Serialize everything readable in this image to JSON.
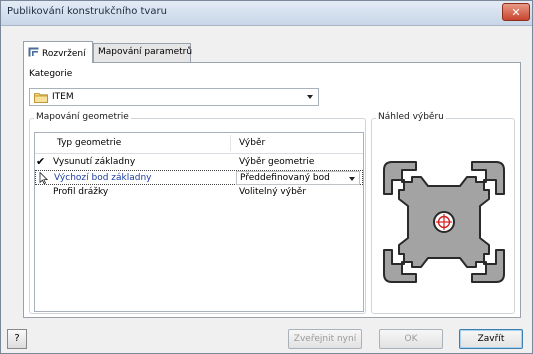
{
  "window": {
    "title": "Publikování konstrukčního tvaru",
    "close_label": "✕"
  },
  "tabs": [
    {
      "label": "Rozvržení",
      "active": true
    },
    {
      "label": "Mapování parametrů",
      "active": false
    }
  ],
  "category": {
    "label": "Kategorie",
    "value": "ITEM",
    "icon": "folder-icon"
  },
  "geometry_mapping": {
    "title": "Mapování geometrie",
    "columns": [
      "Typ geometrie",
      "Výběr"
    ],
    "rows": [
      {
        "type": "Vysunutí základny",
        "selection": "Výběr geometrie",
        "marker": "✔"
      },
      {
        "type": "Výchozí bod základny",
        "selection": "Předdefinovaný bod"
      },
      {
        "type": "Profil drážky",
        "selection": "Volitelný výběr"
      }
    ]
  },
  "preview": {
    "title": "Náhled výběru"
  },
  "buttons": {
    "help": "?",
    "publish": "Zveřejnit nyní",
    "ok": "OK",
    "close": "Zavřít"
  },
  "colors": {
    "profile_fill": "#a3a3a3",
    "profile_stroke": "#2a2a2a",
    "point_marker": "#d42020",
    "selected_text": "#1f3fa7"
  }
}
